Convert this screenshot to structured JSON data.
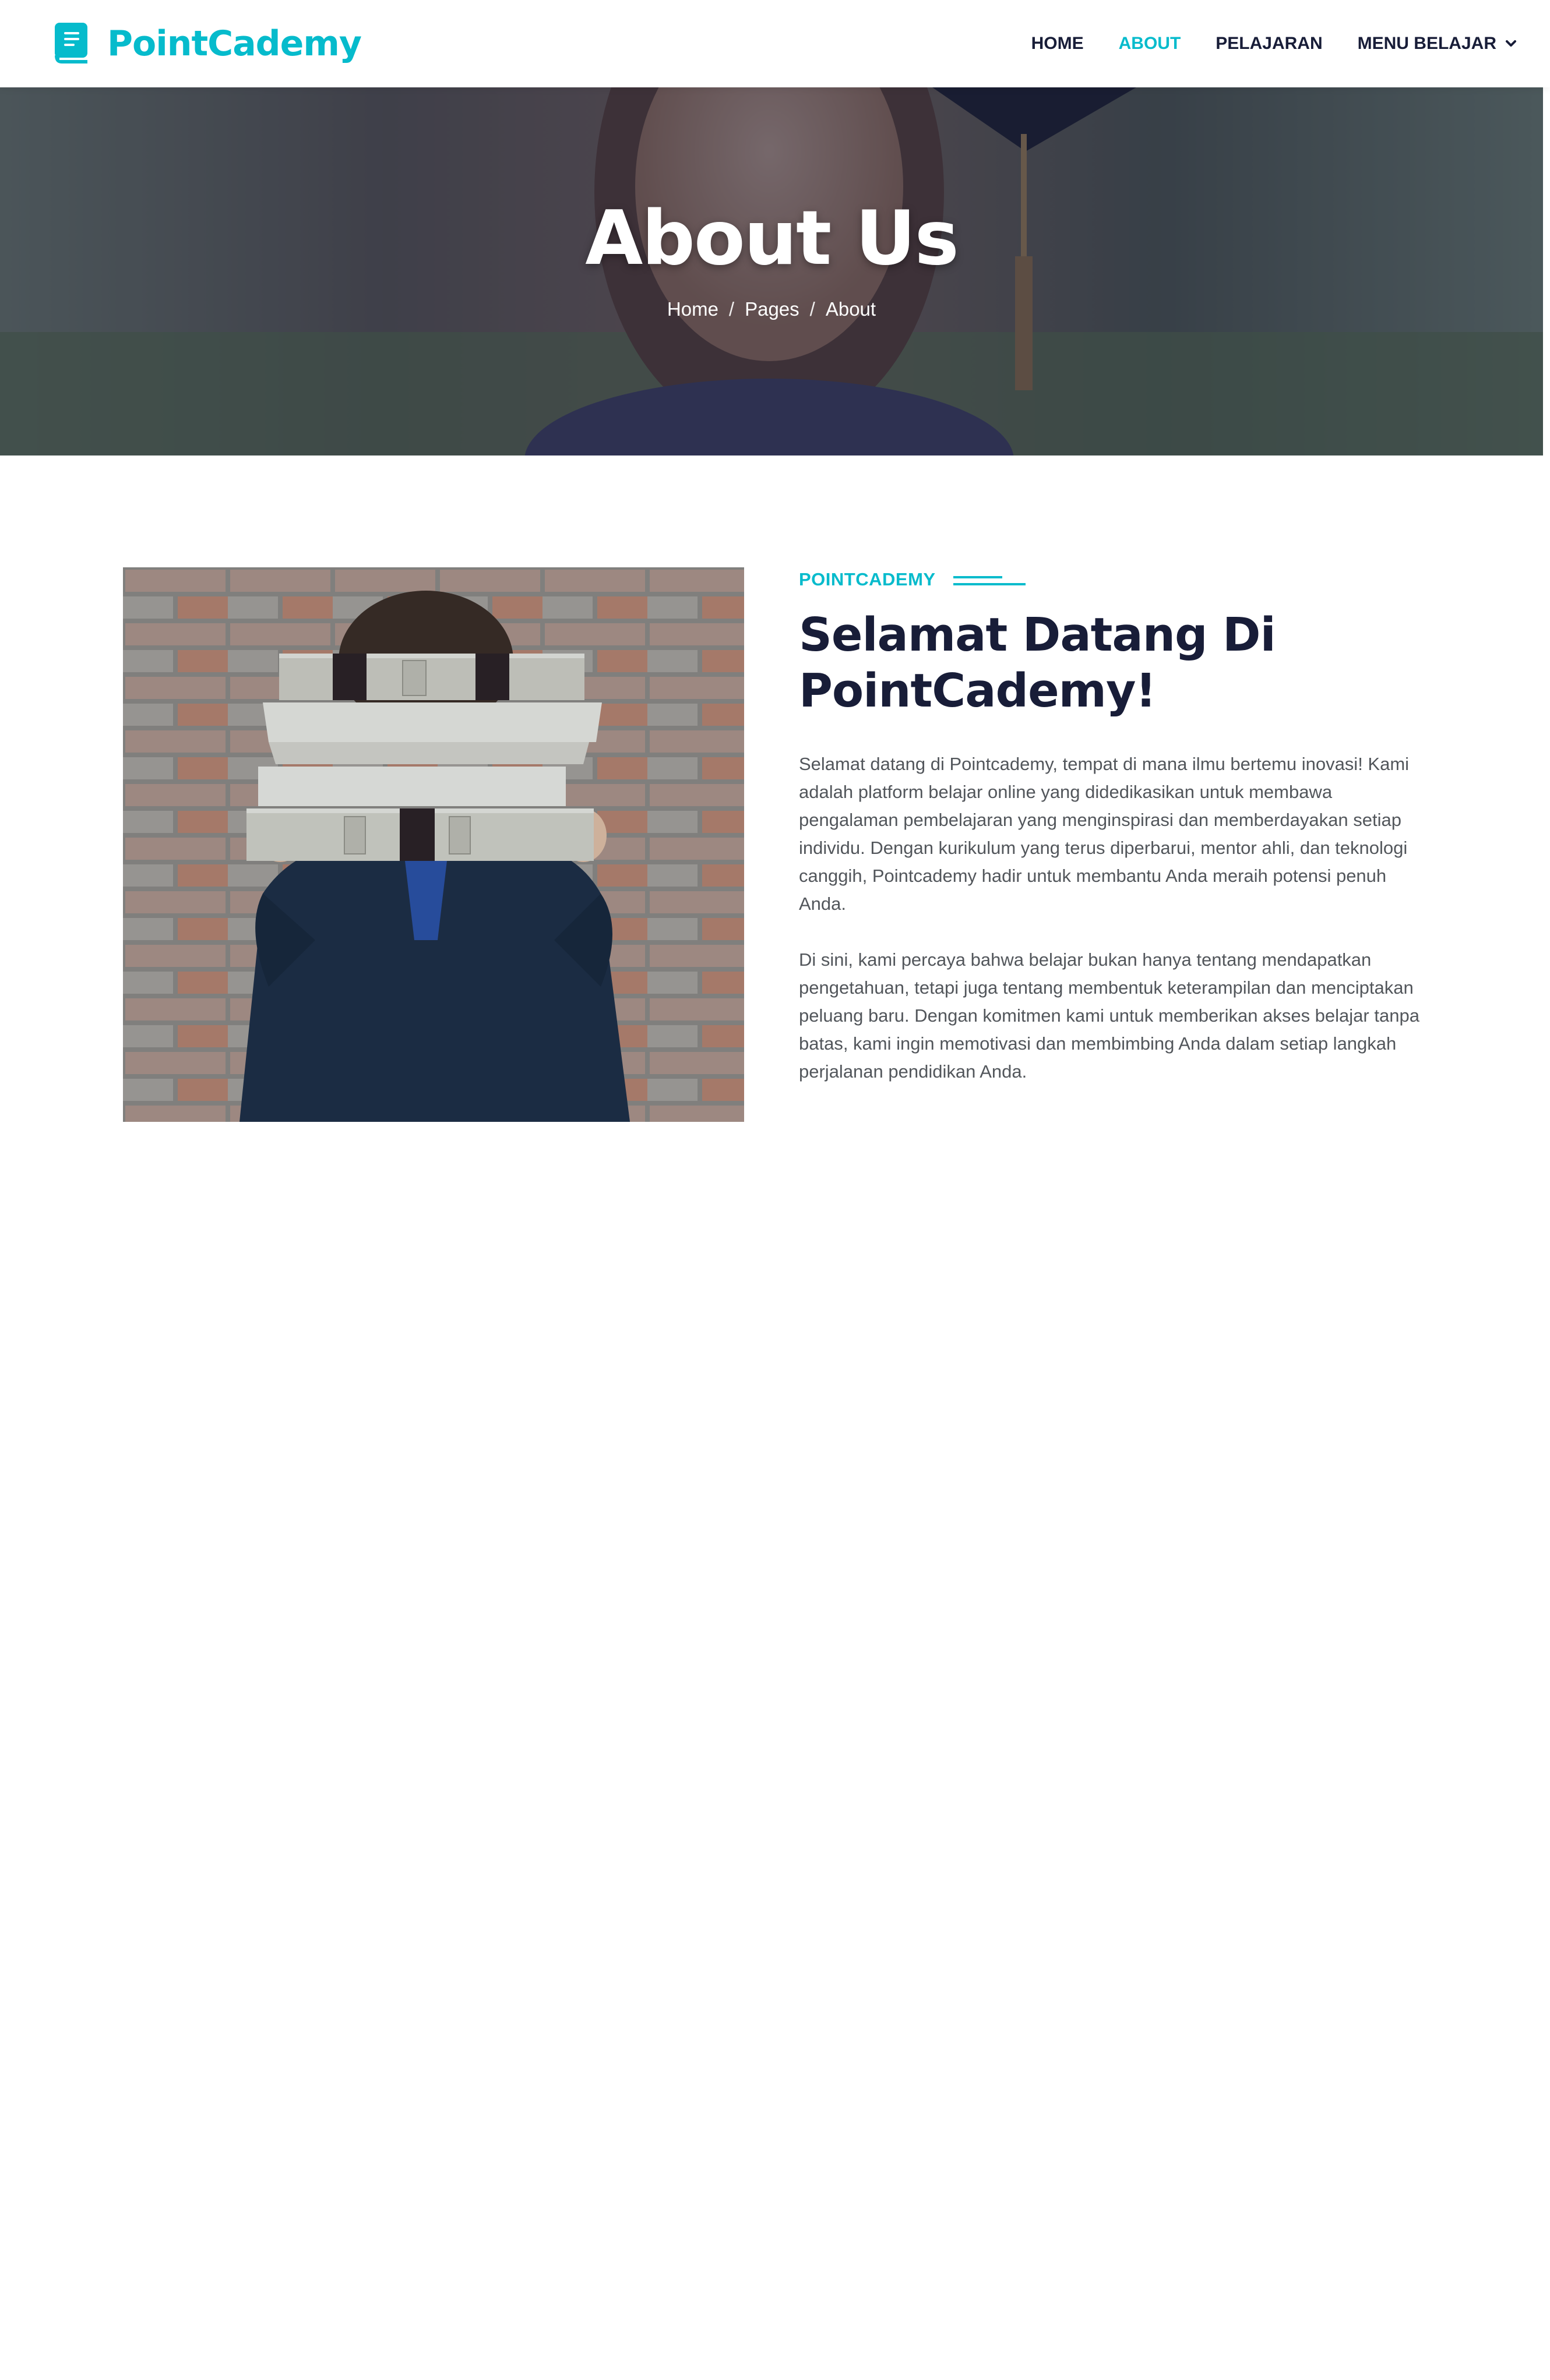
{
  "brand": {
    "name": "PointCademy",
    "icon": "book-icon",
    "color": "#06BBCC"
  },
  "nav": {
    "items": [
      {
        "label": "HOME",
        "active": false
      },
      {
        "label": "ABOUT",
        "active": true
      },
      {
        "label": "PELAJARAN",
        "active": false
      },
      {
        "label": "MENU BELAJAR",
        "active": false,
        "dropdown": true,
        "icon": "chevron-down-icon"
      }
    ]
  },
  "hero": {
    "title": "About Us",
    "breadcrumb": [
      "Home",
      "Pages",
      "About"
    ],
    "separator": "/"
  },
  "about": {
    "eyebrow": "POINTCADEMY",
    "heading_line1": "Selamat Datang Di",
    "heading_line2": "PointCademy!",
    "paragraph1": "Selamat datang di Pointcademy, tempat di mana ilmu bertemu inovasi! Kami adalah platform belajar online yang didedikasikan untuk membawa pengalaman pembelajaran yang menginspirasi dan memberdayakan setiap individu. Dengan kurikulum yang terus diperbarui, mentor ahli, dan teknologi canggih, Pointcademy hadir untuk membantu Anda meraih potensi penuh Anda.",
    "paragraph2": "Di sini, kami percaya bahwa belajar bukan hanya tentang mendapatkan pengetahuan, tetapi juga tentang membentuk keterampilan dan menciptakan peluang baru. Dengan komitmen kami untuk memberikan akses belajar tanpa batas, kami ingin memotivasi dan membimbing Anda dalam setiap langkah perjalanan pendidikan Anda."
  },
  "colors": {
    "primary": "#06BBCC",
    "dark": "#181d38",
    "body_text": "#52565b"
  }
}
